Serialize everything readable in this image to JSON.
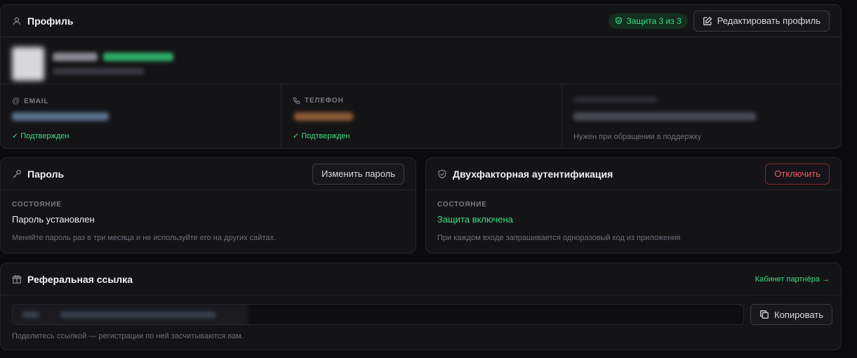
{
  "profile": {
    "title": "Профиль",
    "badge": "Защита 3 из 3",
    "edit_button": "Редактировать профиль",
    "email_label": "EMAIL",
    "email_status": "✓ Подтвержден",
    "phone_label": "ТЕЛЕФОН",
    "phone_status": "✓ Подтвержден",
    "id_note": "Нужен при обращении в поддержку"
  },
  "password": {
    "title": "Пароль",
    "change_button": "Изменить пароль",
    "state_label": "СОСТОЯНИЕ",
    "state_value": "Пароль установлен",
    "hint": "Меняйте пароль раз в три месяца и не используйте его на других сайтах."
  },
  "twofa": {
    "title": "Двухфакторная аутентификация",
    "disable_button": "Отключить",
    "state_label": "СОСТОЯНИЕ",
    "state_value": "Защита включена",
    "hint": "При каждом входе запрашивается одноразовый код из приложения"
  },
  "referral": {
    "title": "Реферальная ссылка",
    "partner_link": "Кабинет партнёра →",
    "copy_button": "Копировать",
    "hint": "Поделитесь ссылкой — регистрации по ней засчитываются вам."
  },
  "colors": {
    "accent_green": "#3ddc84",
    "danger_red": "#ef5a5f",
    "card_bg": "#141417",
    "page_bg": "#0b0b0d"
  }
}
